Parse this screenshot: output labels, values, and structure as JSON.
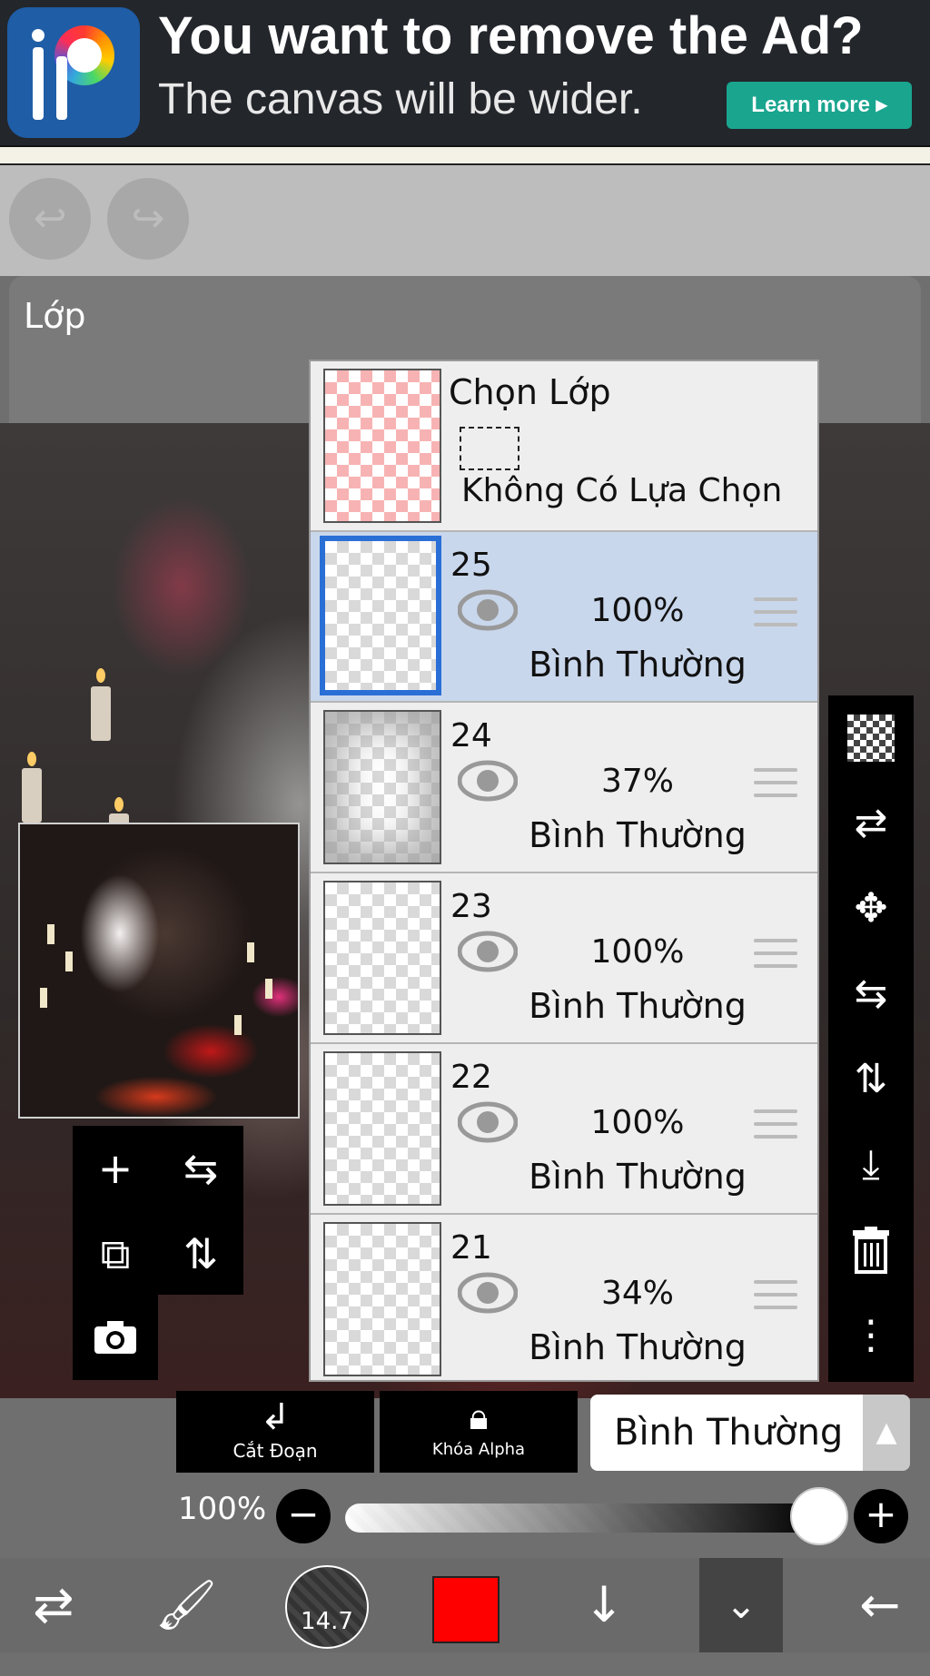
{
  "ad": {
    "title": "You want to remove the Ad?",
    "subtitle": "The canvas will be wider.",
    "button_label": "Learn more ▸"
  },
  "top": {
    "undo_icon": "undo-icon",
    "redo_icon": "redo-icon"
  },
  "panel": {
    "title": "Lớp"
  },
  "selection_layer": {
    "title": "Chọn Lớp",
    "status": "Không Có Lựa Chọn"
  },
  "layers": [
    {
      "name": "25",
      "opacity": "100%",
      "blend": "Bình Thường",
      "selected": true
    },
    {
      "name": "24",
      "opacity": "37%",
      "blend": "Bình Thường",
      "selected": false
    },
    {
      "name": "23",
      "opacity": "100%",
      "blend": "Bình Thường",
      "selected": false
    },
    {
      "name": "22",
      "opacity": "100%",
      "blend": "Bình Thường",
      "selected": false
    },
    {
      "name": "21",
      "opacity": "34%",
      "blend": "Bình Thường",
      "selected": false
    }
  ],
  "bottom_controls": {
    "clip_label": "Cắt Đoạn",
    "alpha_lock_label": "Khóa Alpha",
    "blend_mode": "Bình Thường",
    "opacity_label": "100%",
    "opacity_value": 1.0
  },
  "toolbar": {
    "brush_size": "14.7",
    "color": "#ff0000"
  }
}
